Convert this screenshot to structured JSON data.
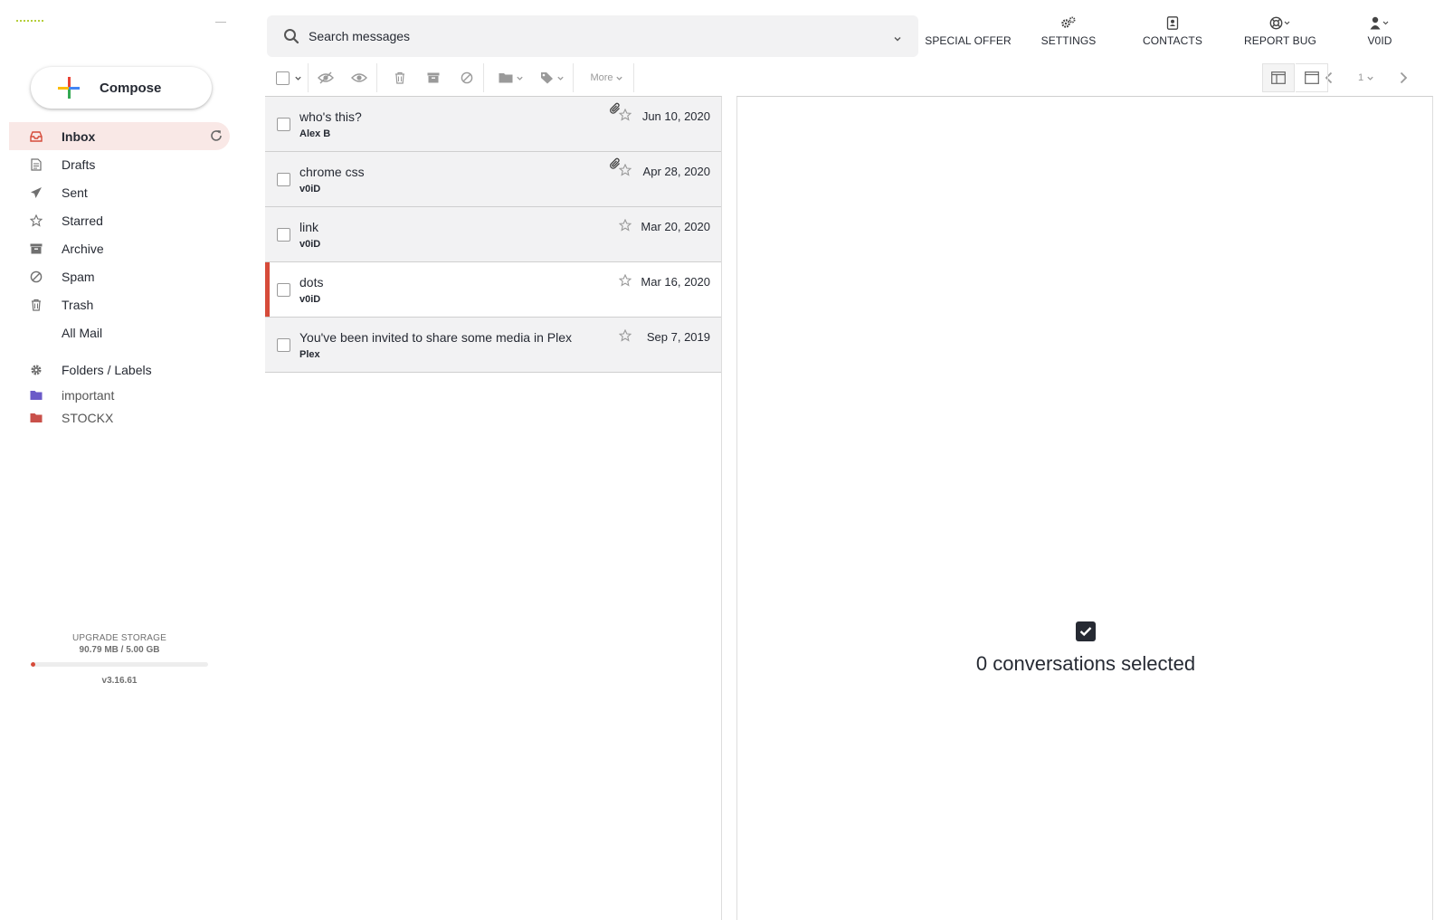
{
  "sidebar": {
    "compose_label": "Compose",
    "nav": [
      {
        "label": "Inbox",
        "icon": "inbox-icon",
        "active": true
      },
      {
        "label": "Drafts",
        "icon": "drafts-icon"
      },
      {
        "label": "Sent",
        "icon": "sent-icon"
      },
      {
        "label": "Starred",
        "icon": "star-icon"
      },
      {
        "label": "Archive",
        "icon": "archive-icon"
      },
      {
        "label": "Spam",
        "icon": "spam-icon"
      },
      {
        "label": "Trash",
        "icon": "trash-icon"
      },
      {
        "label": "All Mail",
        "icon": ""
      }
    ],
    "folders_label": "Folders / Labels",
    "folders": [
      {
        "label": "important",
        "color": "#6b5ac8"
      },
      {
        "label": "STOCKX",
        "color": "#c9504a"
      }
    ],
    "storage": {
      "upgrade_label": "UPGRADE STORAGE",
      "amount": "90.79 MB / 5.00 GB",
      "used_fraction": 0.018,
      "version": "v3.16.61"
    }
  },
  "header": {
    "search_placeholder": "Search messages",
    "nav": {
      "special_offer": "SPECIAL OFFER",
      "settings": "SETTINGS",
      "contacts": "CONTACTS",
      "report_bug": "REPORT BUG",
      "user": "V0ID"
    }
  },
  "toolbar": {
    "more_label": "More",
    "page_number": "1"
  },
  "messages": [
    {
      "subject": "who's this?",
      "sender": "Alex B",
      "date": "Jun 10, 2020",
      "attachment": true,
      "unread": false
    },
    {
      "subject": "chrome css",
      "sender": "v0iD",
      "date": "Apr 28, 2020",
      "attachment": true,
      "unread": false
    },
    {
      "subject": "link",
      "sender": "v0iD",
      "date": "Mar 20, 2020",
      "attachment": false,
      "unread": false
    },
    {
      "subject": "dots",
      "sender": "v0iD",
      "date": "Mar 16, 2020",
      "attachment": false,
      "unread": true
    },
    {
      "subject": "You've been invited to share some media in Plex",
      "sender": "Plex",
      "date": "Sep 7, 2019",
      "attachment": false,
      "unread": false
    }
  ],
  "pane": {
    "selection_text": "0 conversations selected"
  },
  "colors": {
    "accent": "#d64b3a",
    "active_bg": "#f9e8e6",
    "row_read_bg": "#f2f2f3"
  }
}
